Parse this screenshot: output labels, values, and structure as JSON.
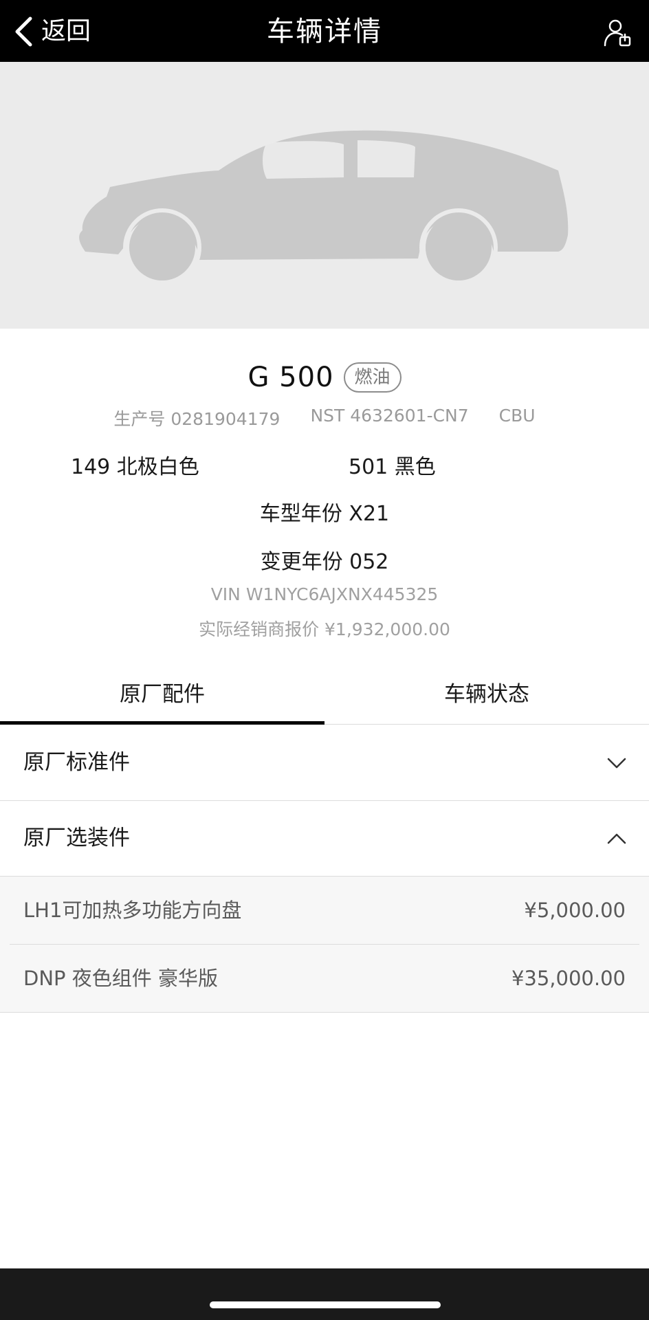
{
  "header": {
    "back_label": "返回",
    "title": "车辆详情",
    "profile_icon": "user-edit-icon"
  },
  "hero": {
    "image": "car-silhouette-placeholder"
  },
  "vehicle": {
    "model": "G 500",
    "fuel_badge": "燃油",
    "production_no": "生产号 0281904179",
    "nst": "NST 4632601-CN7",
    "import_type": "CBU",
    "exterior_color": "149  北极白色",
    "interior_color": "501  黑色",
    "model_year": "车型年份 X21",
    "change_year": "变更年份 052",
    "vin": "VIN W1NYC6AJXNX445325",
    "dealer_price": "实际经销商报价 ¥1,932,000.00"
  },
  "tabs": [
    {
      "label": "原厂配件",
      "active": true
    },
    {
      "label": "车辆状态",
      "active": false
    }
  ],
  "sections": {
    "standard": {
      "label": "原厂标准件",
      "expanded": false
    },
    "optional": {
      "label": "原厂选装件",
      "expanded": true,
      "items": [
        {
          "name": "LH1可加热多功能方向盘",
          "price": "¥5,000.00"
        },
        {
          "name": "DNP 夜色组件 豪华版",
          "price": "¥35,000.00"
        }
      ]
    }
  }
}
